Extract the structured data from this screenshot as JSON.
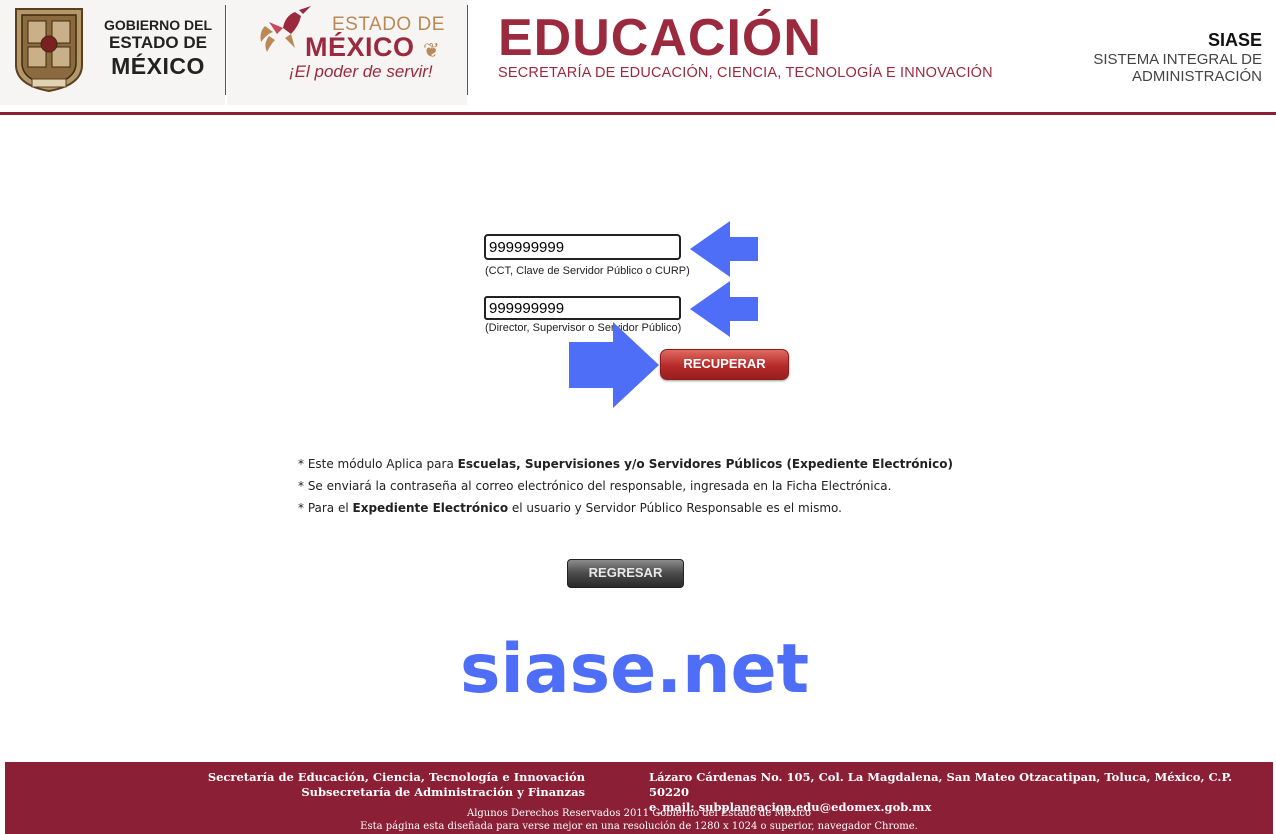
{
  "header": {
    "gov": {
      "line1": "GOBIERNO DEL",
      "line2": "ESTADO DE",
      "line3": "MÉXICO"
    },
    "estado": {
      "line1": "ESTADO DE",
      "line2": "MÉXICO",
      "slogan": "¡El poder de servir!"
    },
    "title": "EDUCACIÓN",
    "subtitle": "SECRETARÍA DE EDUCACIÓN, CIENCIA, TECNOLOGÍA E INNOVACIÓN",
    "system": {
      "name": "SIASE",
      "line1": "SISTEMA INTEGRAL DE",
      "line2": "ADMINISTRACIÓN"
    }
  },
  "form": {
    "field1_value": "999999999",
    "field1_hint": "(CCT, Clave de Servidor Público o CURP)",
    "field2_value": "999999999",
    "field2_hint": "(Director, Supervisor o Servidor Público)",
    "recuperar_label": "RECUPERAR"
  },
  "notes": {
    "n1_pre": "* Este módulo Aplica para ",
    "n1_bold": "Escuelas, Supervisiones y/o Servidores Públicos (Expediente Electrónico)",
    "n2": "* Se enviará la contraseña al correo electrónico del responsable, ingresada en la Ficha Electrónica.",
    "n3_pre": "* Para el ",
    "n3_bold": "Expediente Electrónico",
    "n3_post": " el usuario y Servidor Público Responsable es el mismo."
  },
  "regresar_label": "REGRESAR",
  "watermark": "siase.net",
  "footer": {
    "left1": "Secretaría de Educación, Ciencia, Tecnología e Innovación",
    "left2": "Subsecretaría de Administración y Finanzas",
    "right1": "Lázaro Cárdenas No. 105, Col. La Magdalena, San Mateo Otzacatipan, Toluca, México, C.P. 50220",
    "right2": "e_mail: subplaneacion.edu@edomex.gob.mx",
    "small1": "Algunos Derechos Reservados 2011 Gobierno del Estado de México",
    "small2": "Esta página esta diseñada para verse mejor en una resolución de 1280 x 1024 o superior, navegador Chrome."
  },
  "colors": {
    "brand": "#8b1f36",
    "accent_blue": "#4f6ef7",
    "gold": "#b98a57"
  },
  "icons": [
    "coat-of-arms-icon",
    "hummingbird-icon",
    "leaf-icon",
    "arrow-left-icon",
    "arrow-right-icon"
  ]
}
